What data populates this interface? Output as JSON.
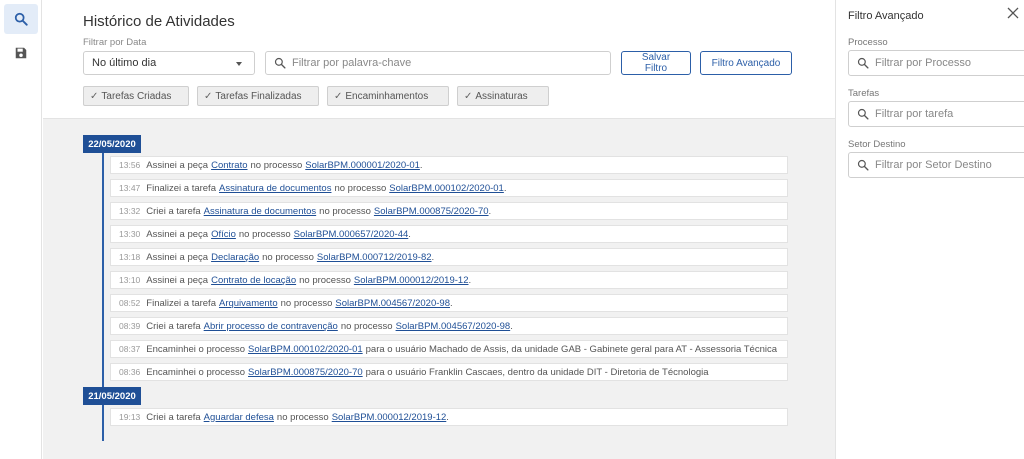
{
  "main": {
    "title": "Histórico de Atividades",
    "filter_label": "Filtrar por Data",
    "date_select": "No último dia",
    "keyword_placeholder": "Filtrar por palavra-chave",
    "save_filter": "Salvar Filtro",
    "advanced_filter": "Filtro Avançado",
    "chips": [
      "Tarefas Criadas",
      "Tarefas Finalizadas",
      "Encaminhamentos",
      "Assinaturas"
    ]
  },
  "timeline": {
    "groups": [
      {
        "date": "22/05/2020",
        "entries": [
          {
            "time": "13:56",
            "t1": "Assinei a peça",
            "l1": "Contrato",
            "t2": "no processo",
            "l2": "SolarBPM.000001/2020-01",
            "t3": "."
          },
          {
            "time": "13:47",
            "t1": "Finalizei a tarefa",
            "l1": "Assinatura de documentos",
            "t2": "no processo",
            "l2": "SolarBPM.000102/2020-01",
            "t3": "."
          },
          {
            "time": "13:32",
            "t1": "Criei a tarefa",
            "l1": "Assinatura de documentos",
            "t2": "no processo",
            "l2": "SolarBPM.000875/2020-70",
            "t3": "."
          },
          {
            "time": "13:30",
            "t1": "Assinei a peça",
            "l1": "Ofício",
            "t2": "no processo",
            "l2": "SolarBPM.000657/2020-44",
            "t3": "."
          },
          {
            "time": "13:18",
            "t1": "Assinei a peça",
            "l1": "Declaração",
            "t2": "no processo",
            "l2": "SolarBPM.000712/2019-82",
            "t3": "."
          },
          {
            "time": "13:10",
            "t1": "Assinei a peça",
            "l1": "Contrato de locação",
            "t2": "no processo",
            "l2": "SolarBPM.000012/2019-12",
            "t3": "."
          },
          {
            "time": "08:52",
            "t1": "Finalizei a tarefa",
            "l1": "Arquivamento",
            "t2": "no processo",
            "l2": "SolarBPM.004567/2020-98",
            "t3": "."
          },
          {
            "time": "08:39",
            "t1": "Criei a tarefa",
            "l1": "Abrir processo de contravenção",
            "t2": "no processo",
            "l2": "SolarBPM.004567/2020-98",
            "t3": "."
          },
          {
            "time": "08:37",
            "t1": "Encaminhei o processo",
            "l1": "SolarBPM.000102/2020-01",
            "t2": "para o usuário Machado de Assis, da unidade GAB - Gabinete geral para AT - Assessoria Técnica",
            "l2": "",
            "t3": ""
          },
          {
            "time": "08:36",
            "t1": "Encaminhei o processo",
            "l1": "SolarBPM.000875/2020-70",
            "t2": "para o usuário Franklin Cascaes, dentro da unidade DIT - Diretoria de Técnologia",
            "l2": "",
            "t3": ""
          }
        ]
      },
      {
        "date": "21/05/2020",
        "entries": [
          {
            "time": "19:13",
            "t1": "Criei a tarefa",
            "l1": "Aguardar defesa",
            "t2": "no processo",
            "l2": "SolarBPM.000012/2019-12",
            "t3": "."
          }
        ]
      }
    ]
  },
  "side": {
    "title": "Filtro Avançado",
    "processo_label": "Processo",
    "processo_placeholder": "Filtrar por Processo",
    "tarefas_label": "Tarefas",
    "tarefas_placeholder": "Filtrar por tarefa",
    "setor_label": "Setor Destino",
    "setor_placeholder": "Filtrar por Setor Destino"
  },
  "colors": {
    "accent": "#2c5fa8",
    "badge": "#1f4f96",
    "timeline_bg": "#f1f1f1"
  }
}
